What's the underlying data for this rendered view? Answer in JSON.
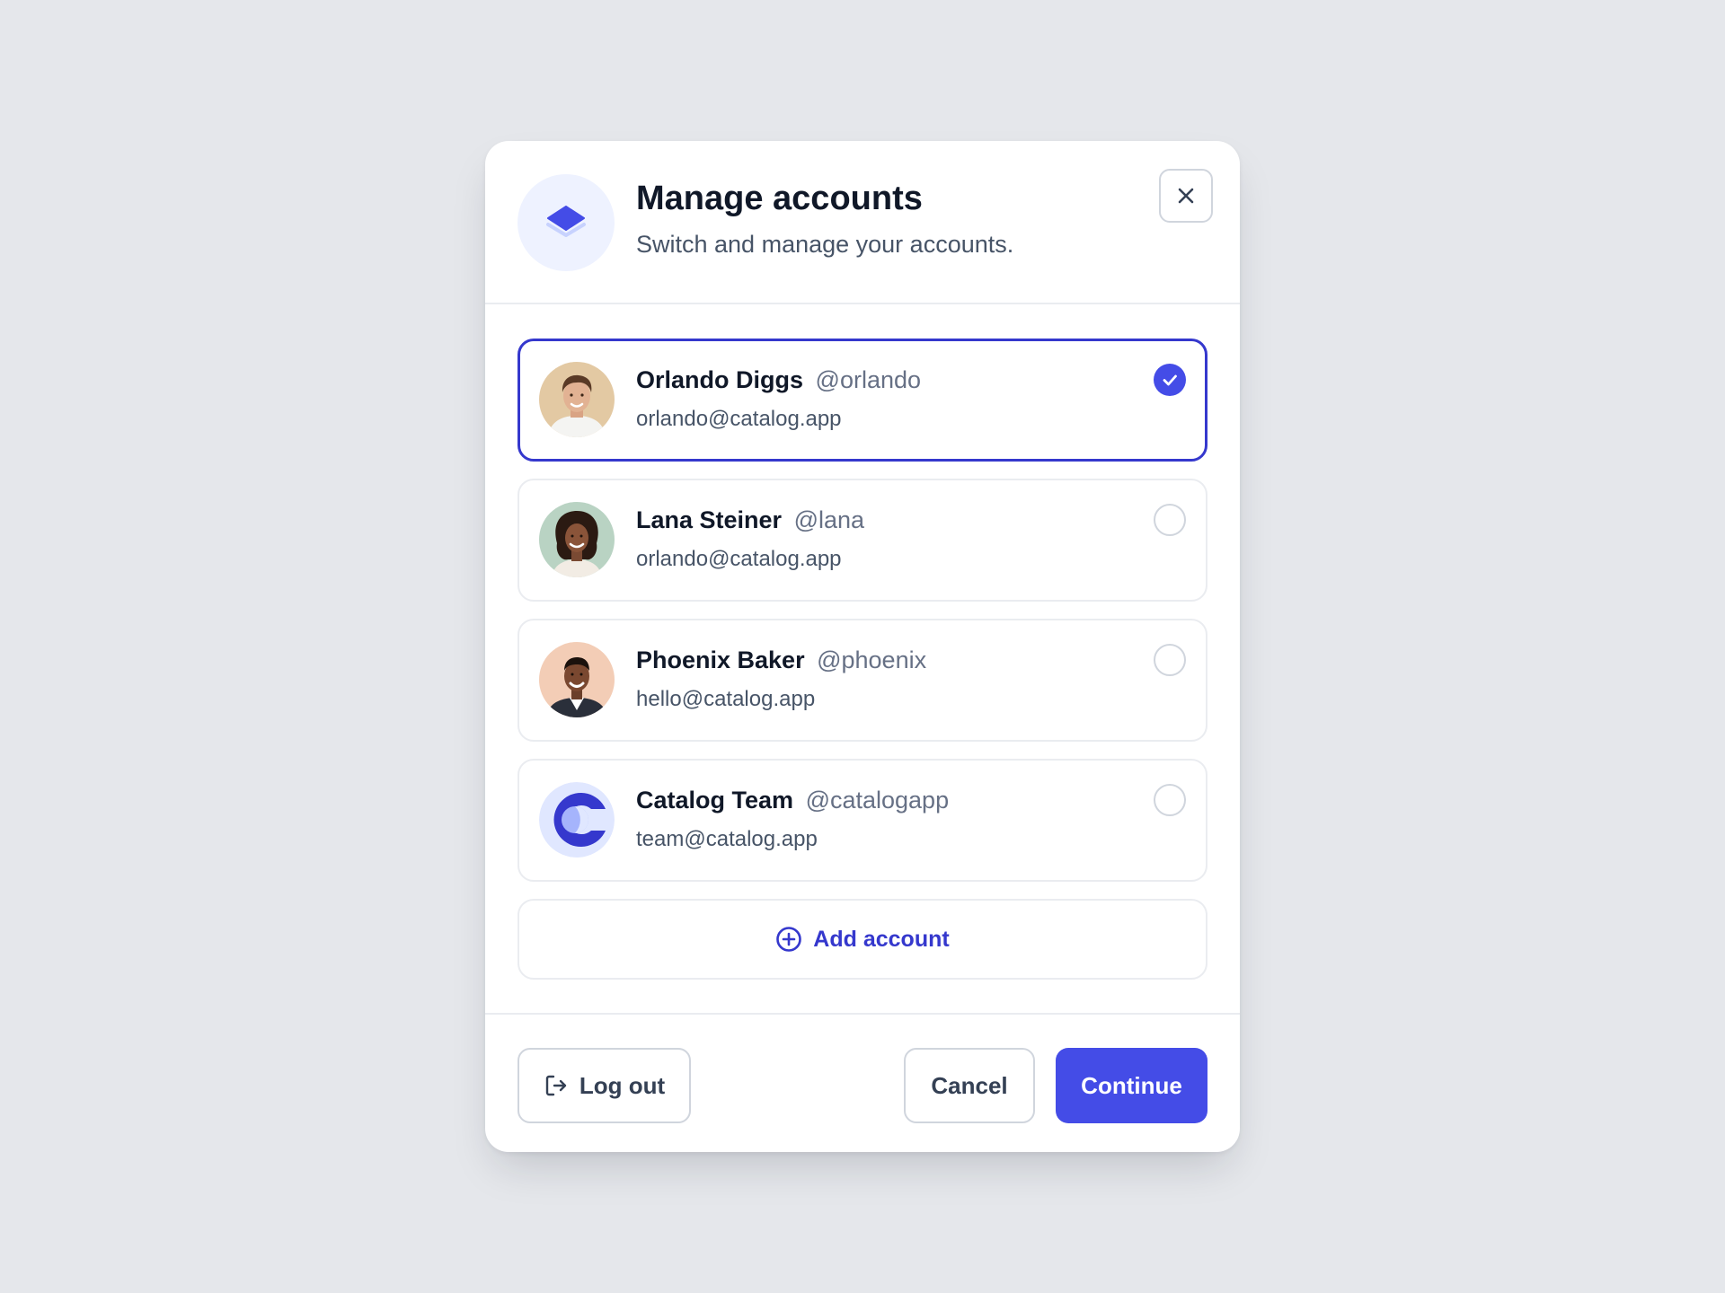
{
  "dialog": {
    "title": "Manage accounts",
    "subtitle": "Switch and manage your accounts.",
    "icon": "layers-icon",
    "close_icon": "close-icon"
  },
  "accounts": [
    {
      "name": "Orlando Diggs",
      "handle": "@orlando",
      "email": "orlando@catalog.app",
      "selected": true,
      "avatar": "photo-avatar-orlando"
    },
    {
      "name": "Lana Steiner",
      "handle": "@lana",
      "email": "orlando@catalog.app",
      "selected": false,
      "avatar": "photo-avatar-lana"
    },
    {
      "name": "Phoenix Baker",
      "handle": "@phoenix",
      "email": "hello@catalog.app",
      "selected": false,
      "avatar": "photo-avatar-phoenix"
    },
    {
      "name": "Catalog Team",
      "handle": "@catalogapp",
      "email": "team@catalog.app",
      "selected": false,
      "avatar": "catalog-logo-avatar"
    }
  ],
  "add_account": {
    "label": "Add account",
    "icon": "plus-circle-icon"
  },
  "footer": {
    "logout_label": "Log out",
    "logout_icon": "log-out-icon",
    "cancel_label": "Cancel",
    "continue_label": "Continue"
  },
  "colors": {
    "page_background": "#e5e7eb",
    "brand": "#444ce7",
    "brand_dark": "#3538cd",
    "selected_border": "#3538cd"
  }
}
